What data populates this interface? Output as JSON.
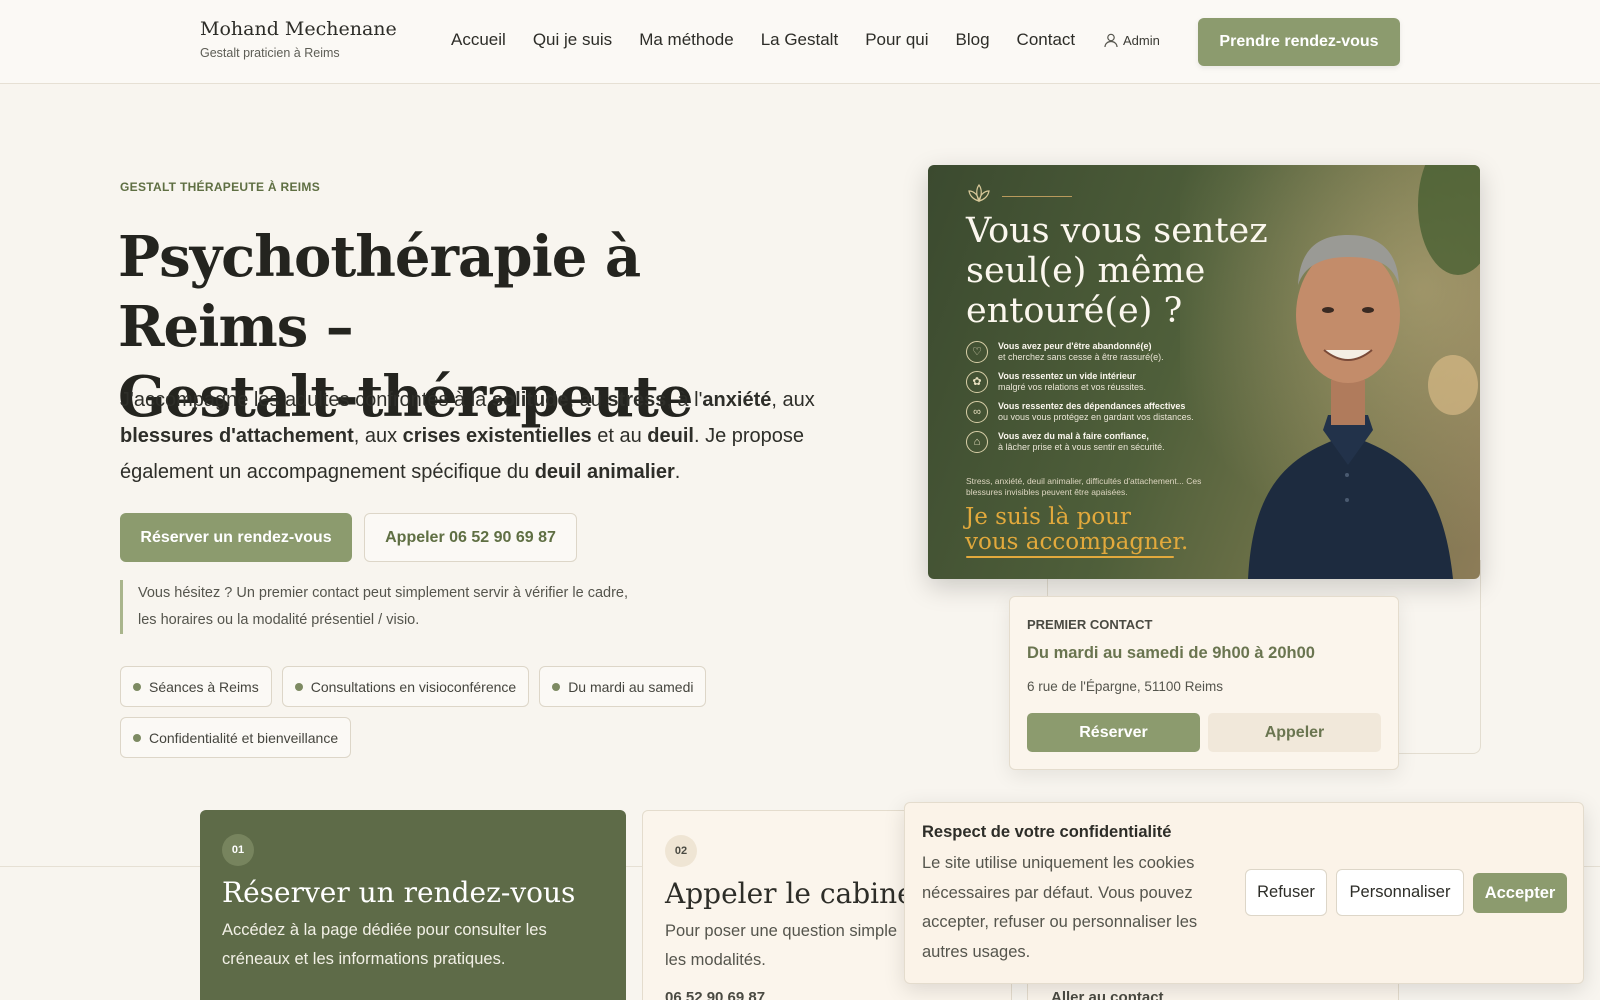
{
  "header": {
    "brand_name": "Mohand Mechenane",
    "brand_sub": "Gestalt praticien à Reims",
    "nav": [
      "Accueil",
      "Qui je suis",
      "Ma méthode",
      "La Gestalt",
      "Pour qui",
      "Blog",
      "Contact"
    ],
    "admin_label": "Admin",
    "cta_label": "Prendre rendez-vous"
  },
  "hero": {
    "eyebrow": "GESTALT THÉRAPEUTE À REIMS",
    "title_line1": "Psychothérapie à Reims –",
    "title_line2": "Gestalt-thérapeute",
    "lead": {
      "t1": "J'accompagne les adultes confrontés à la ",
      "b1": "solitude",
      "t2": ", au ",
      "b2": "stress",
      "t3": ", à l'",
      "b3": "anxiété",
      "t4": ", aux ",
      "b4": "blessures d'attachement",
      "t5": ", aux ",
      "b5": "crises existentielles",
      "t6": " et au ",
      "b6": "deuil",
      "t7": ". Je propose également un accompagnement spécifique du ",
      "b7": "deuil animalier",
      "t8": "."
    },
    "btn_primary": "Réserver un rendez-vous",
    "btn_call": "Appeler 06 52 90 69 87",
    "hint_line1": "Vous hésitez ? Un premier contact peut simplement servir à vérifier le cadre,",
    "hint_line2": "les horaires ou la modalité présentiel / visio.",
    "chips": [
      "Séances à Reims",
      "Consultations en visioconférence",
      "Du mardi au samedi",
      "Confidentialité et bienveillance"
    ]
  },
  "hero_image": {
    "title": "Vous vous sentez seul(e) même entouré(e) ?",
    "items": [
      {
        "icon": "heart-icon",
        "glyph": "♡",
        "bold": "Vous avez peur d'être abandonné(e)",
        "text": "et cherchez sans cesse à être rassuré(e)."
      },
      {
        "icon": "flower-icon",
        "glyph": "✿",
        "bold": "Vous ressentez un vide intérieur",
        "text": "malgré vos relations et vos réussites."
      },
      {
        "icon": "link-icon",
        "glyph": "∞",
        "bold": "Vous ressentez des dépendances affectives",
        "text": "ou vous vous protégez en gardant vos distances."
      },
      {
        "icon": "lock-icon",
        "glyph": "⌂",
        "bold": "Vous avez du mal à faire confiance,",
        "text": "à lâcher prise et à vous sentir en sécurité."
      }
    ],
    "foot": "Stress, anxiété, deuil animalier, difficultés d'attachement... Ces blessures invisibles peuvent être apaisées.",
    "cta_line1": "Je suis là pour",
    "cta_line2": "vous accompagner."
  },
  "contact_card": {
    "label": "PREMIER CONTACT",
    "hours": "Du mardi au samedi de 9h00 à 20h00",
    "address": "6 rue de l'Épargne, 51100 Reims",
    "btn_reserve": "Réserver",
    "btn_call": "Appeler"
  },
  "steps": [
    {
      "num": "01",
      "title": "Réserver un rendez-vous",
      "text": "Accédez à la page dédiée pour consulter les créneaux et les informations pratiques."
    },
    {
      "num": "02",
      "title": "Appeler le cabinet",
      "text_line1": "Pour poser une question simple",
      "text_line2": "les modalités.",
      "link": "06 52 90 69 87"
    },
    {
      "link": "Aller au contact"
    }
  ],
  "cookie": {
    "title": "Respect de votre confidentialité",
    "text": "Le site utilise uniquement les cookies nécessaires par défaut. Vous pouvez accepter, refuser ou personnaliser les autres usages.",
    "refuse": "Refuser",
    "customize": "Personnaliser",
    "accept": "Accepter"
  },
  "colors": {
    "accent": "#8c9b6e",
    "dark_green": "#5e6b48",
    "background": "#f8f5ef",
    "gold": "#e2a93c"
  }
}
